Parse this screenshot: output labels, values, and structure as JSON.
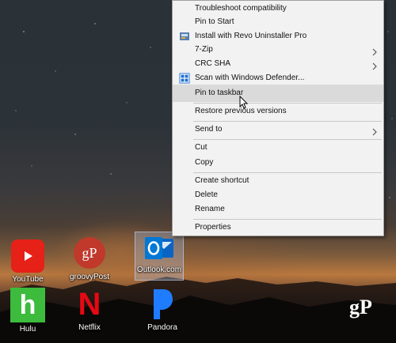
{
  "context_menu": {
    "items": [
      {
        "label": "Troubleshoot compatibility"
      },
      {
        "label": "Pin to Start"
      },
      {
        "label": "Install with Revo Uninstaller Pro"
      },
      {
        "label": "7-Zip"
      },
      {
        "label": "CRC SHA"
      },
      {
        "label": "Scan with Windows Defender..."
      },
      {
        "label": "Pin to taskbar"
      },
      {
        "label": "Restore previous versions"
      },
      {
        "label": "Send to"
      },
      {
        "label": "Cut"
      },
      {
        "label": "Copy"
      },
      {
        "label": "Create shortcut"
      },
      {
        "label": "Delete"
      },
      {
        "label": "Rename"
      },
      {
        "label": "Properties"
      }
    ],
    "hovered_item": "Pin to taskbar"
  },
  "desktop_icons": [
    {
      "label": "YouTube",
      "color": "#e62117"
    },
    {
      "label": "groovyPost",
      "color": "#c0392b",
      "glyph": "gP"
    },
    {
      "label": "Outlook.com",
      "color": "#0072c6",
      "glyph": "O",
      "selected": true
    },
    {
      "label": "Hulu",
      "color": "#3dbb3d",
      "glyph": "h"
    },
    {
      "label": "Netflix",
      "color": "#e50914",
      "glyph": "N"
    },
    {
      "label": "Pandora",
      "color": "#224099",
      "glyph": "P"
    }
  ],
  "watermark": "gP"
}
